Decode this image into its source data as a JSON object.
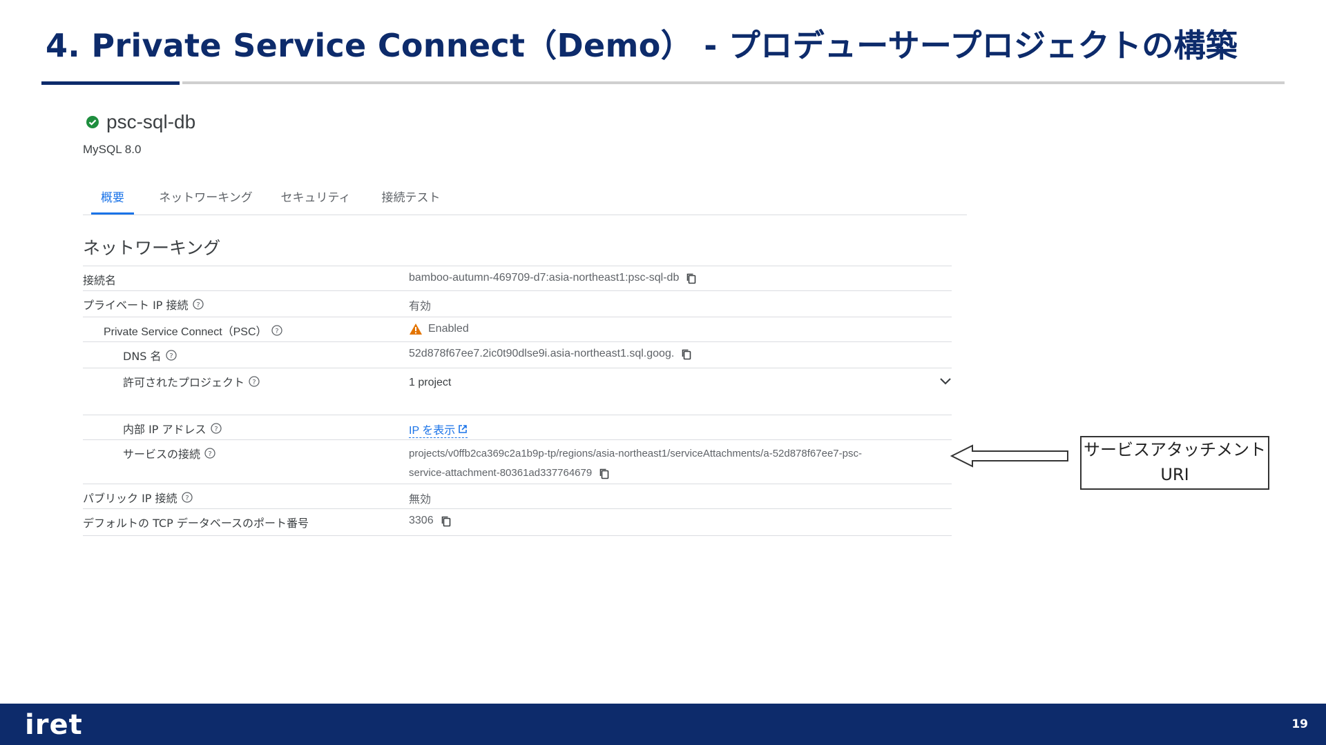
{
  "slide": {
    "title": "4. Private Service Connect（Demo） - プロデューサープロジェクトの構築",
    "page_number": "19",
    "logo_text": "iret"
  },
  "instance": {
    "name": "psc-sql-db",
    "engine": "MySQL 8.0",
    "status_icon": "check-circle-icon",
    "status_color": "#1e8e3e"
  },
  "tabs": [
    {
      "label": "概要",
      "active": true
    },
    {
      "label": "ネットワーキング",
      "active": false
    },
    {
      "label": "セキュリティ",
      "active": false
    },
    {
      "label": "接続テスト",
      "active": false
    }
  ],
  "section": {
    "title": "ネットワーキング"
  },
  "rows": {
    "connection_name": {
      "label": "接続名",
      "value": "bamboo-autumn-469709-d7:asia-northeast1:psc-sql-db"
    },
    "private_ip": {
      "label": "プライベート IP 接続",
      "value": "有効"
    },
    "psc": {
      "label": "Private Service Connect（PSC）",
      "value": "Enabled"
    },
    "dns": {
      "label": "DNS 名",
      "value": "52d878f67ee7.2ic0t90dlse9i.asia-northeast1.sql.goog."
    },
    "allowed_projects": {
      "label": "許可されたプロジェクト",
      "value": "1 project"
    },
    "internal_ip": {
      "label": "内部 IP アドレス",
      "value": "IP を表示"
    },
    "service_connection": {
      "label": "サービスの接続",
      "value_line1": "projects/v0ffb2ca369c2a1b9p-tp/regions/asia-northeast1/serviceAttachments/a-52d878f67ee7-psc-",
      "value_line2": "service-attachment-80361ad337764679"
    },
    "public_ip": {
      "label": "パブリック IP 接続",
      "value": "無効"
    },
    "default_port": {
      "label": "デフォルトの TCP データベースのポート番号",
      "value": "3306"
    }
  },
  "annotation": {
    "line1": "サービスアタッチメント",
    "line2": "URI"
  },
  "colors": {
    "title_navy": "#0d2b6b",
    "accent_blue": "#1a73e8",
    "warning_orange": "#e37400"
  }
}
